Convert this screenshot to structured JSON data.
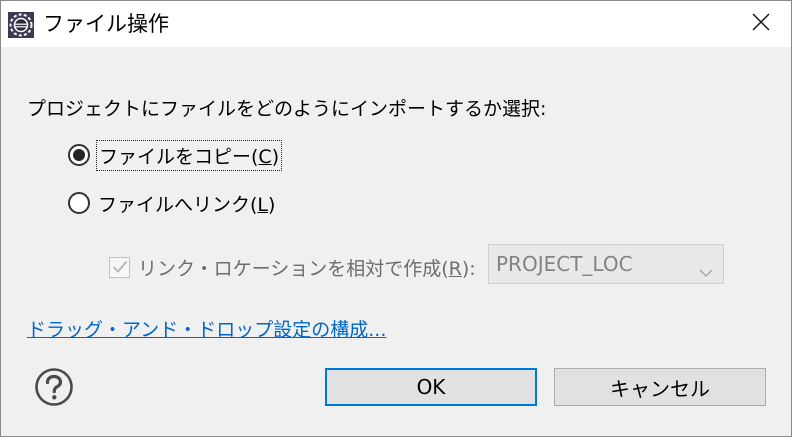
{
  "window": {
    "title": "ファイル操作"
  },
  "prompt": "プロジェクトにファイルをどのようにインポートするか選択:",
  "options": {
    "copy": {
      "label": "ファイルをコピー(",
      "mnemonic": "C",
      "suffix": ")",
      "selected": true
    },
    "link": {
      "label": "ファイルへリンク(",
      "mnemonic": "L",
      "suffix": ")",
      "selected": false
    }
  },
  "location": {
    "label": "リンク・ロケーションを相対で作成(",
    "mnemonic": "R",
    "suffix": "):",
    "checked": true,
    "enabled": false,
    "combo_value": "PROJECT_LOC"
  },
  "config_link": "ドラッグ・アンド・ドロップ設定の構成...",
  "buttons": {
    "ok": "OK",
    "cancel": "キャンセル"
  },
  "icons": {
    "app": "eclipse-icon",
    "close": "close-icon",
    "help": "help-icon"
  },
  "colors": {
    "link": "#0066cc",
    "default_button_border": "#0078d7",
    "dialog_background": "#f0f0f0"
  }
}
